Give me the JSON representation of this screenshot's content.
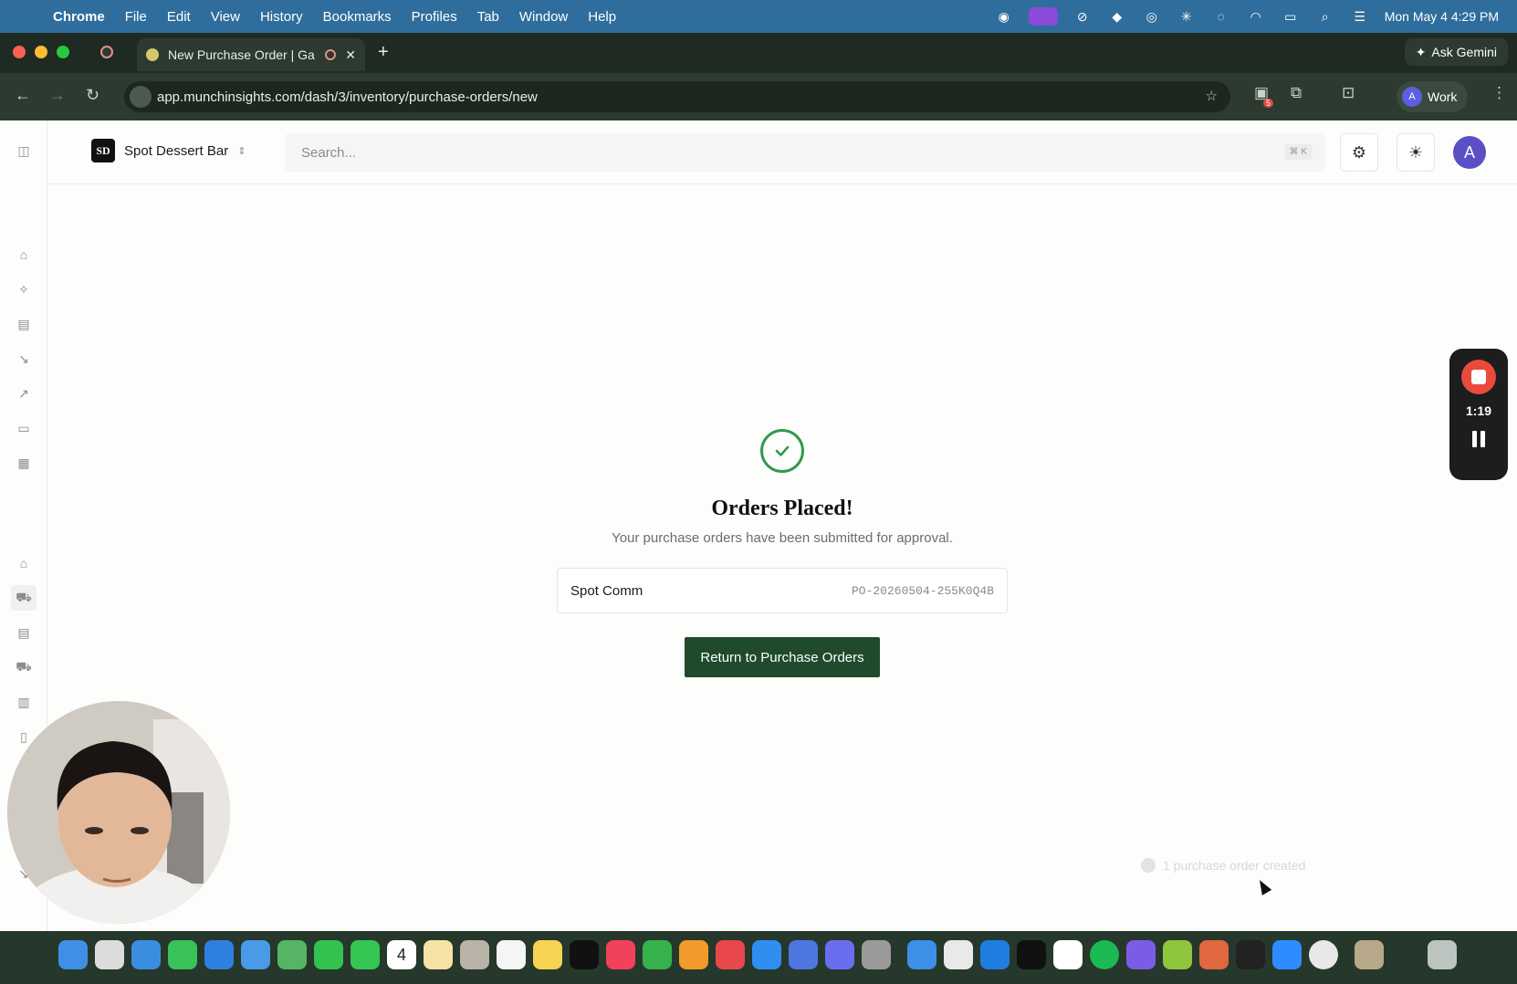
{
  "menubar": {
    "app": "Chrome",
    "items": [
      "File",
      "Edit",
      "View",
      "History",
      "Bookmarks",
      "Profiles",
      "Tab",
      "Window",
      "Help"
    ],
    "clock": "Mon May 4  4:29 PM"
  },
  "browser": {
    "tab_title": "New Purchase Order | Ga",
    "url": "app.munchinsights.com/dash/3/inventory/purchase-orders/new",
    "gemini_label": "Ask Gemini",
    "profile_label": "Work",
    "profile_initial": "A",
    "extension_badge": "5"
  },
  "header": {
    "store_initials": "SD",
    "store_name": "Spot Dessert Bar",
    "search_placeholder": "Search...",
    "search_shortcut": "⌘ K",
    "avatar_initial": "A"
  },
  "main": {
    "heading": "Orders Placed!",
    "subtext": "Your purchase orders have been submitted for approval.",
    "orders": [
      {
        "supplier": "Spot Comm",
        "po_number": "PO-20260504-255K0Q4B"
      }
    ],
    "return_button": "Return to Purchase Orders"
  },
  "toast": {
    "text": "1 purchase order created"
  },
  "recorder": {
    "elapsed": "1:19"
  },
  "colors": {
    "accent_green": "#1f4a2b",
    "success_green": "#2f9a4f",
    "avatar_purple": "#5b4fc6",
    "record_red": "#e84a3c"
  },
  "dock": {
    "icons": [
      "finder-icon",
      "launchpad-icon",
      "safari-icon",
      "messages-icon",
      "keynote-icon",
      "mail-icon",
      "maps-icon",
      "facetime-icon",
      "phone-icon",
      "calendar-icon",
      "photos-icon",
      "contacts-icon",
      "reminders-icon",
      "notes-icon",
      "tv-icon",
      "music-icon",
      "numbers-icon",
      "pages-icon",
      "rocket-icon",
      "appstore-icon",
      "ipad-icon",
      "discord-icon",
      "settings-icon",
      "preview-icon",
      "linear-icon",
      "xcode-icon",
      "terminal-icon",
      "notion-icon",
      "spotify-icon",
      "arc-icon",
      "chatgpt-icon",
      "claude-icon",
      "cube-icon",
      "zoom-icon",
      "chrome-icon",
      "folder-icon",
      "trash-icon"
    ],
    "calendar_day": "4"
  }
}
